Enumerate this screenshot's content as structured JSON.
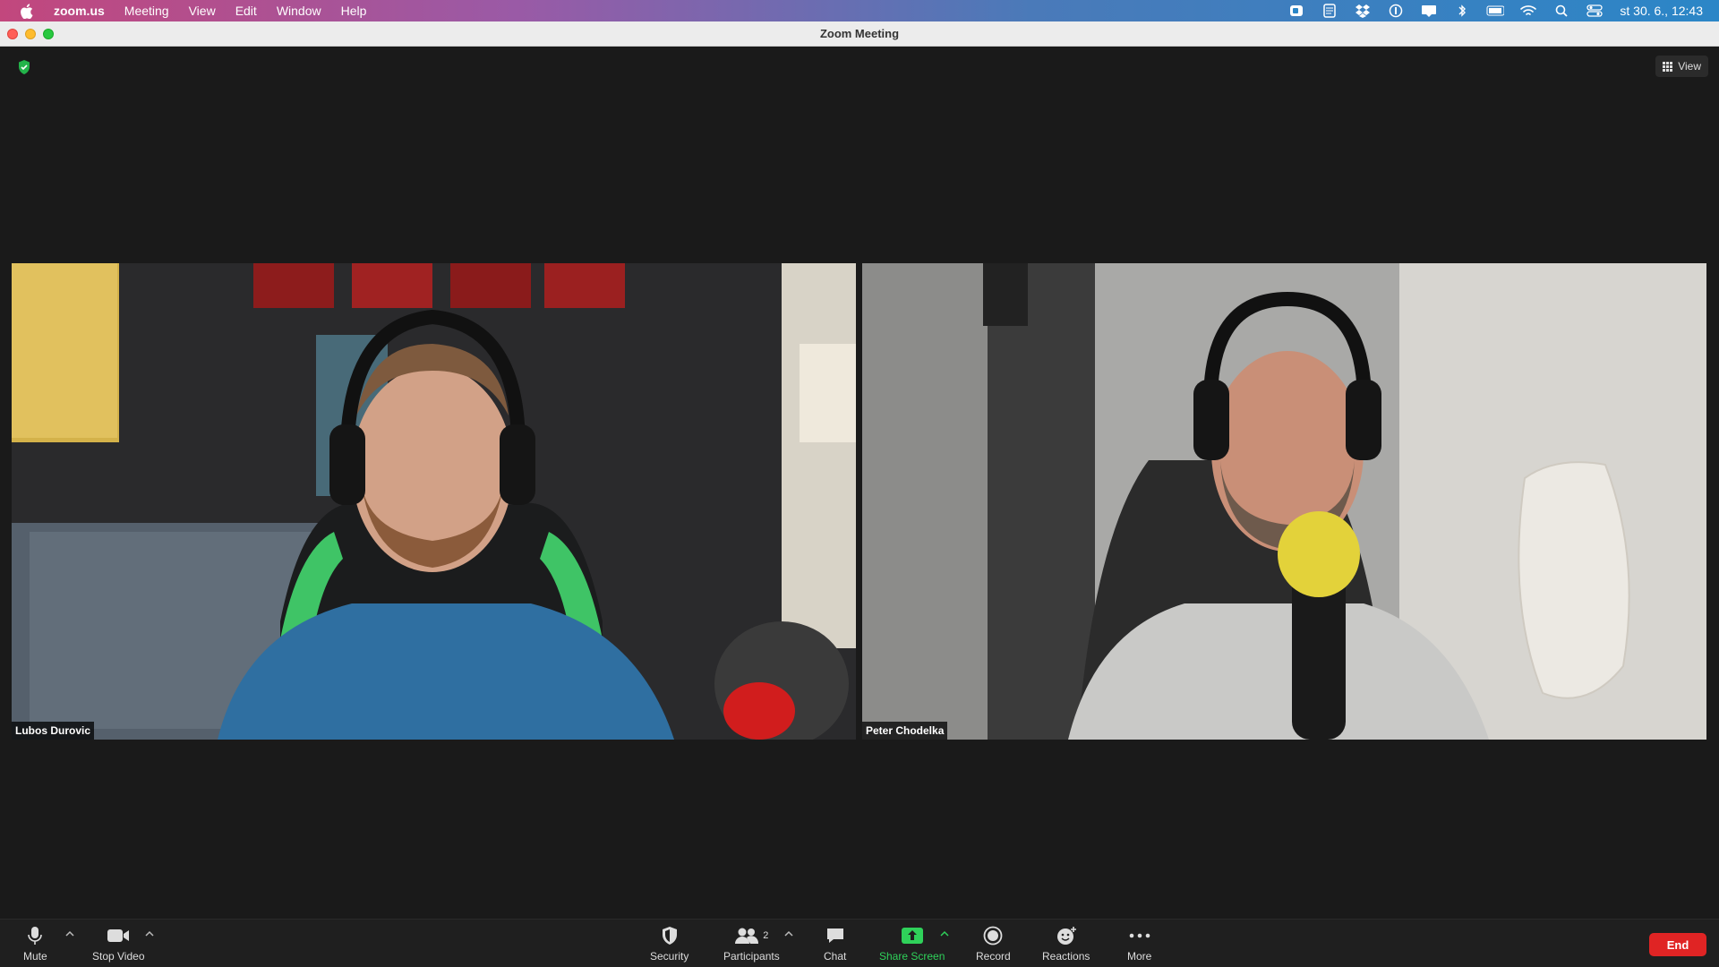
{
  "menubar": {
    "app_name": "zoom.us",
    "items": [
      "Meeting",
      "View",
      "Edit",
      "Window",
      "Help"
    ],
    "status_icons": [
      "zoom-icon",
      "notes-icon",
      "dropbox-icon",
      "onepassword-icon",
      "notification-icon",
      "bluetooth-icon",
      "battery-icon",
      "wifi-icon",
      "spotlight-icon",
      "control-center-icon"
    ],
    "clock": "st 30. 6., 12:43"
  },
  "window": {
    "title": "Zoom Meeting"
  },
  "stage": {
    "view_label": "View"
  },
  "participants": [
    {
      "name": "Lubos Durovic"
    },
    {
      "name": "Peter Chodelka"
    }
  ],
  "toolbar": {
    "mute": "Mute",
    "stop_video": "Stop Video",
    "security": "Security",
    "participants": "Participants",
    "participants_count": "2",
    "chat": "Chat",
    "share_screen": "Share Screen",
    "record": "Record",
    "reactions": "Reactions",
    "more": "More",
    "end": "End"
  },
  "colors": {
    "accent_green": "#2fd15a",
    "end_red": "#e02424",
    "background": "#1a1a1a"
  }
}
